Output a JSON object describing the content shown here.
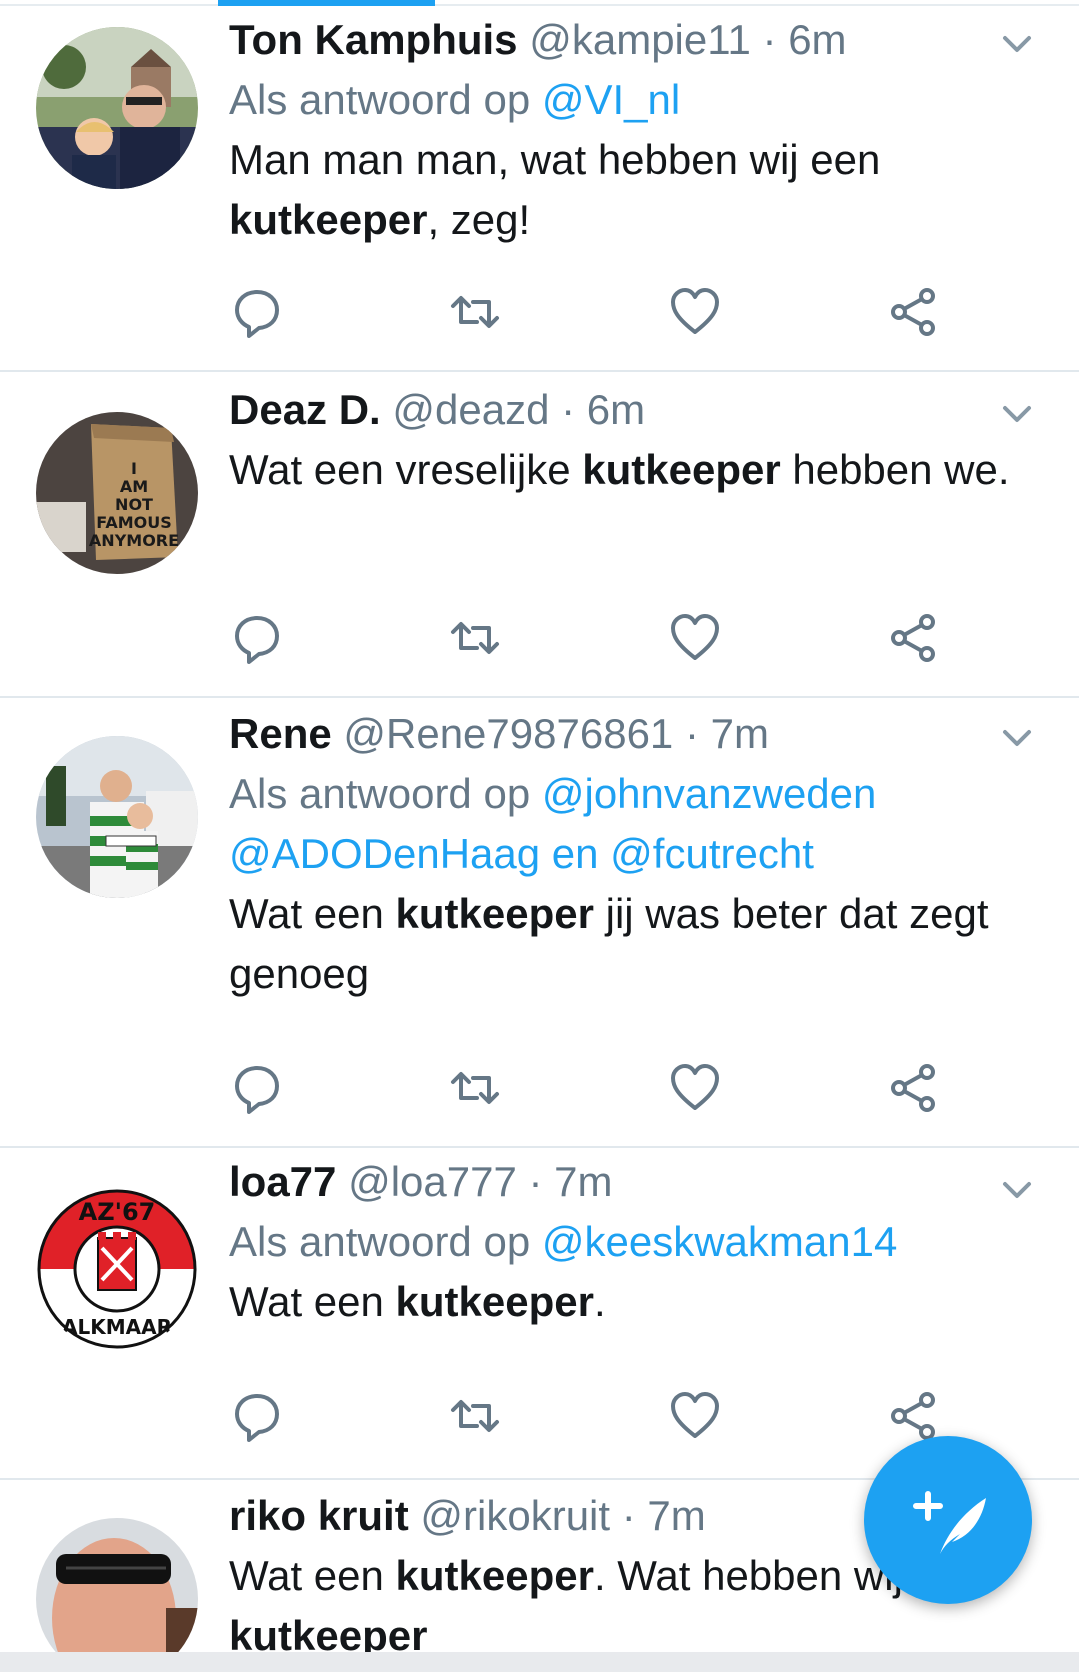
{
  "colors": {
    "accent": "#1da1f2",
    "secondary_text": "#657786",
    "divider": "#e1e8ed"
  },
  "tweets": [
    {
      "name": "Ton Kamphuis",
      "handle": "@kampie11",
      "time": "6m",
      "reply_prefix": "Als antwoord op",
      "reply_mentions": "@VI_nl",
      "text_before": "Man man man, wat hebben wij een ",
      "text_bold": "kutkeeper",
      "text_after": ", zeg!"
    },
    {
      "name": "Deaz D.",
      "handle": "@deazd",
      "time": "6m",
      "text_before": "Wat een vreselijke ",
      "text_bold": "kutkeeper",
      "text_after": " hebben we."
    },
    {
      "name": "Rene",
      "handle": "@Rene79876861",
      "time": "7m",
      "reply_prefix": "Als antwoord op",
      "reply_mention_1": "@johnvanzweden",
      "reply_mention_2": "@ADODenHaag",
      "reply_and": "en",
      "reply_mention_3": "@fcutrecht",
      "text_before": "Wat een ",
      "text_bold": "kutkeeper",
      "text_after": " jij was beter dat zegt genoeg"
    },
    {
      "name": "loa77",
      "handle": "@loa777",
      "time": "7m",
      "reply_prefix": "Als antwoord op",
      "reply_mentions": "@keeskwakman14",
      "text_before": "Wat een ",
      "text_bold": "kutkeeper",
      "text_after": ".",
      "avatar_text_top": "AZ'67",
      "avatar_text_bottom": "ALKMAAR"
    },
    {
      "name": "riko kruit",
      "handle": "@rikokruit",
      "time": "7m",
      "text_before": "Wat een ",
      "text_bold": "kutkeeper",
      "text_after": ". Wat hebben wij een ",
      "text_bold_2": "kutkeeper"
    }
  ],
  "avatar_sign_text": [
    "I",
    "AM",
    "NOT",
    "FAMOUS",
    "ANYMORE"
  ],
  "icons": {
    "reply": "reply-icon",
    "retweet": "retweet-icon",
    "like": "heart-icon",
    "share": "share-icon",
    "menu": "chevron-down-icon",
    "compose": "compose-tweet-icon"
  }
}
